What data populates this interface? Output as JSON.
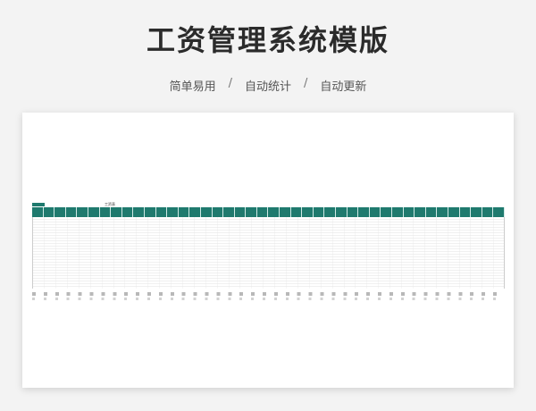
{
  "title": "工资管理系统模版",
  "features": [
    "简单易用",
    "自动统计",
    "自动更新"
  ],
  "separator": "/",
  "sheet": {
    "title": "工资表",
    "header_count": 42
  },
  "colors": {
    "accent": "#1f7a6e",
    "title": "#2b2b2b"
  }
}
